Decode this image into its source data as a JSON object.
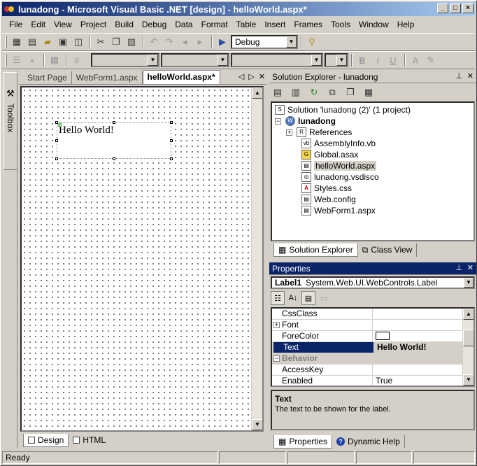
{
  "window": {
    "title": "lunadong - Microsoft Visual Basic .NET [design] - helloWorld.aspx*"
  },
  "menu": [
    "File",
    "Edit",
    "View",
    "Project",
    "Build",
    "Debug",
    "Data",
    "Format",
    "Table",
    "Insert",
    "Frames",
    "Tools",
    "Window",
    "Help"
  ],
  "toolbar": {
    "config": "Debug"
  },
  "toolbox": {
    "label": "Toolbox"
  },
  "document": {
    "tabs": [
      "Start Page",
      "WebForm1.aspx",
      "helloWorld.aspx*"
    ],
    "label_text": "Hello World!",
    "view_tabs": [
      "Design",
      "HTML"
    ]
  },
  "solution_explorer": {
    "title": "Solution Explorer - lunadong",
    "solution": "Solution 'lunadong (2)' (1 project)",
    "project": "lunadong",
    "items": [
      "References",
      "AssemblyInfo.vb",
      "Global.asax",
      "helloWorld.aspx",
      "lunadong.vsdisco",
      "Styles.css",
      "Web.config",
      "WebForm1.aspx"
    ],
    "tabs": [
      "Solution Explorer",
      "Class View"
    ]
  },
  "properties": {
    "title": "Properties",
    "object": "Label1",
    "object_type": "System.Web.UI.WebControls.Label",
    "rows": [
      {
        "name": "CssClass",
        "value": ""
      },
      {
        "name": "Font",
        "value": ""
      },
      {
        "name": "ForeColor",
        "value": ""
      },
      {
        "name": "Text",
        "value": "Hello World!"
      },
      {
        "name": "Behavior",
        "value": ""
      },
      {
        "name": "AccessKey",
        "value": ""
      },
      {
        "name": "Enabled",
        "value": "True"
      }
    ],
    "desc_title": "Text",
    "desc_text": "The text to be shown for the label.",
    "tabs": [
      "Properties",
      "Dynamic Help"
    ]
  },
  "status": {
    "text": "Ready"
  }
}
